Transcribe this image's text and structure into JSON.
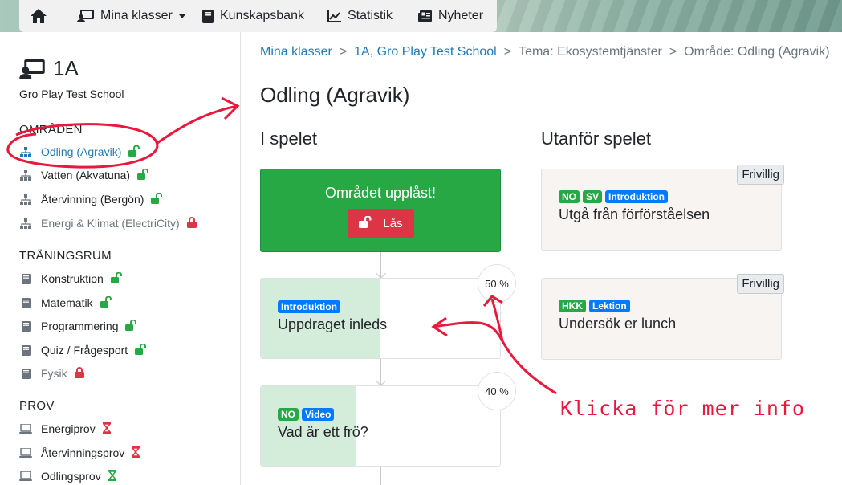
{
  "navbar": {
    "home_icon": "home-icon",
    "items": [
      {
        "label": "Mina klasser",
        "icon": "class-icon",
        "dropdown": true
      },
      {
        "label": "Kunskapsbank",
        "icon": "book-icon"
      },
      {
        "label": "Statistik",
        "icon": "chart-icon"
      },
      {
        "label": "Nyheter",
        "icon": "news-icon"
      }
    ]
  },
  "sidebar": {
    "class_name": "1A",
    "school": "Gro Play Test School",
    "areas_heading": "OMRÅDEN",
    "areas": [
      {
        "label": "Odling (Agravik)",
        "icon": "sitemap-icon",
        "lock": "unlocked",
        "active": true
      },
      {
        "label": "Vatten (Akvatuna)",
        "icon": "sitemap-icon",
        "lock": "unlocked"
      },
      {
        "label": "Återvinning (Bergön)",
        "icon": "sitemap-icon",
        "lock": "unlocked"
      },
      {
        "label": "Energi & Klimat (ElectriCity)",
        "icon": "sitemap-icon",
        "lock": "locked"
      }
    ],
    "training_heading": "TRÄNINGSRUM",
    "training": [
      {
        "label": "Konstruktion",
        "icon": "book-icon",
        "lock": "unlocked"
      },
      {
        "label": "Matematik",
        "icon": "book-icon",
        "lock": "unlocked"
      },
      {
        "label": "Programmering",
        "icon": "book-icon",
        "lock": "unlocked"
      },
      {
        "label": "Quiz / Frågesport",
        "icon": "book-icon",
        "lock": "unlocked"
      },
      {
        "label": "Fysik",
        "icon": "book-icon",
        "lock": "locked"
      }
    ],
    "exams_heading": "PROV",
    "exams": [
      {
        "label": "Energiprov",
        "icon": "laptop-icon",
        "status": "hourglass-red"
      },
      {
        "label": "Återvinningsprov",
        "icon": "laptop-icon",
        "status": "hourglass-red"
      },
      {
        "label": "Odlingsprov",
        "icon": "laptop-icon",
        "status": "hourglass-green"
      }
    ]
  },
  "breadcrumb": {
    "items": [
      "Mina klasser",
      "1A, Gro Play Test School",
      "Tema: Ekosystemtjänster",
      "Område: Odling (Agravik)"
    ],
    "separator": ">"
  },
  "main": {
    "title": "Odling (Agravik)",
    "in_game_heading": "I spelet",
    "outside_heading": "Utanför spelet",
    "unlock_card": {
      "title": "Området upplåst!",
      "button_label": "Lås"
    },
    "tasks": [
      {
        "badges": [
          {
            "text": "Introduktion",
            "color": "#007bff"
          }
        ],
        "title": "Uppdraget inleds",
        "progress_label": "50 %",
        "progress": 0.5
      },
      {
        "badges": [
          {
            "text": "NO",
            "color": "#28a745"
          },
          {
            "text": "Video",
            "color": "#007bff"
          }
        ],
        "title": "Vad är ett frö?",
        "progress_label": "40 %",
        "progress": 0.4
      }
    ],
    "extras": [
      {
        "badges": [
          {
            "text": "NO",
            "color": "#28a745"
          },
          {
            "text": "SV",
            "color": "#28a745"
          },
          {
            "text": "Introduktion",
            "color": "#007bff"
          }
        ],
        "title": "Utgå från förförståelsen",
        "tag": "Frivillig"
      },
      {
        "badges": [
          {
            "text": "HKK",
            "color": "#28a745"
          },
          {
            "text": "Lektion",
            "color": "#007bff"
          }
        ],
        "title": "Undersök er lunch",
        "tag": "Frivillig"
      }
    ]
  },
  "annotation": {
    "text": "Klicka för mer info",
    "color": "#e8193c"
  },
  "colors": {
    "link": "#1f7ab8",
    "success": "#28a745",
    "danger": "#dc3545",
    "primary": "#007bff"
  }
}
